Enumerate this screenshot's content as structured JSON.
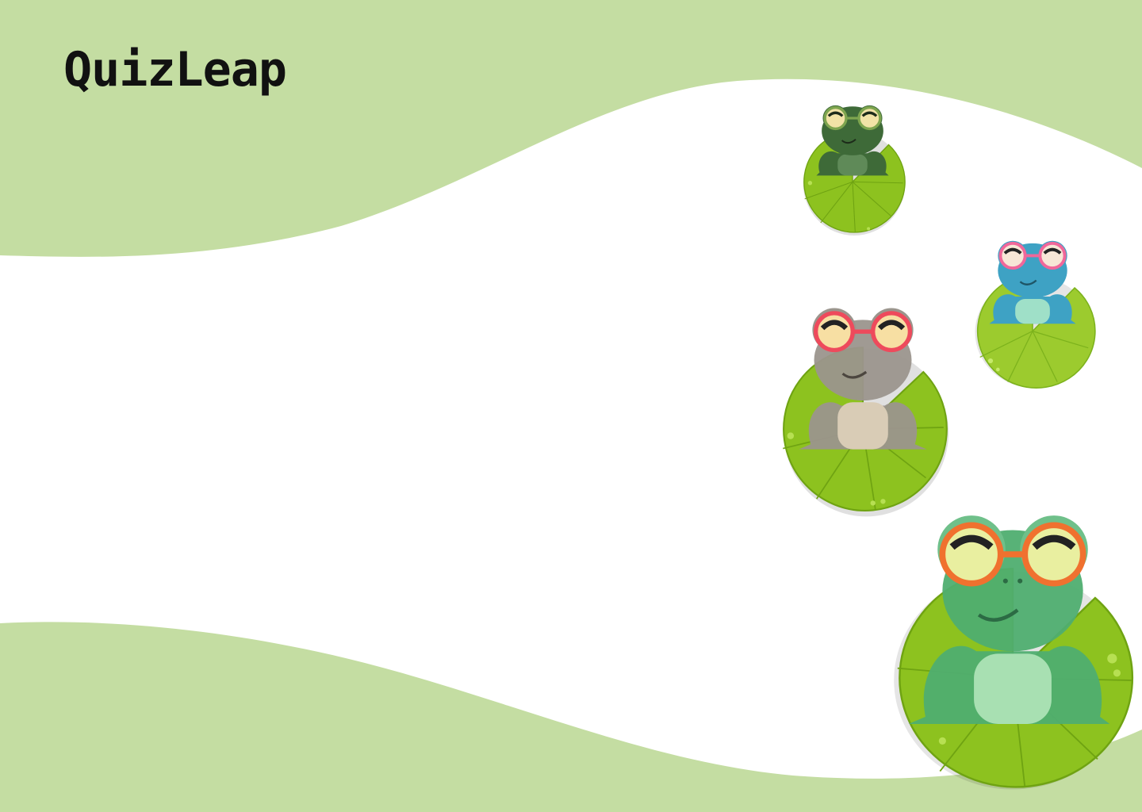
{
  "brand": {
    "name": "QuizLeap"
  },
  "colors": {
    "wave": "#c4dda2",
    "background": "#ffffff",
    "text": "#111111",
    "pad_light": "#8dc21f",
    "pad_dark": "#6fa312"
  },
  "characters": [
    {
      "name": "frog-dark-green",
      "icon": "frog-on-lily-pad-icon",
      "body": "#3e6a38",
      "belly": "#5f8a58",
      "glasses": "#7ea54f"
    },
    {
      "name": "frog-blue",
      "icon": "frog-on-lily-pad-icon",
      "body": "#3ea2c4",
      "belly": "#9fe0c8",
      "glasses": "#f0679a"
    },
    {
      "name": "frog-grey",
      "icon": "frog-on-lily-pad-icon",
      "body": "#9b958d",
      "belly": "#d9ccb6",
      "glasses": "#ee4a5c"
    },
    {
      "name": "frog-green",
      "icon": "frog-on-lily-pad-icon",
      "body": "#4fae70",
      "belly": "#a8e0b2",
      "glasses": "#f0712f"
    }
  ]
}
